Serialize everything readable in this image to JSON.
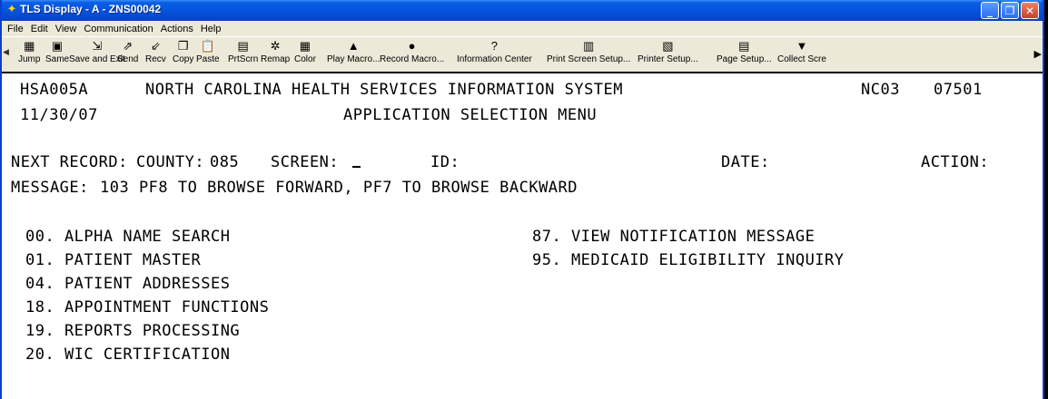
{
  "window": {
    "title": "TLS Display - A - ZNS00042"
  },
  "menu": [
    "File",
    "Edit",
    "View",
    "Communication",
    "Actions",
    "Help"
  ],
  "toolbar": [
    {
      "label": "Jump",
      "icon": "jump-icon",
      "glyph": "▦"
    },
    {
      "label": "Same",
      "icon": "same-icon",
      "glyph": "▣"
    },
    {
      "label": "Save and Exit",
      "icon": "save-exit-icon",
      "glyph": "⇲"
    },
    {
      "label": "Send",
      "icon": "send-icon",
      "glyph": "⇗"
    },
    {
      "label": "Recv",
      "icon": "recv-icon",
      "glyph": "⇙"
    },
    {
      "label": "Copy",
      "icon": "copy-icon",
      "glyph": "❐"
    },
    {
      "label": "Paste",
      "icon": "paste-icon",
      "glyph": "📋"
    },
    {
      "label": "PrtScrn",
      "icon": "print-screen-icon",
      "glyph": "▤"
    },
    {
      "label": "Remap",
      "icon": "remap-icon",
      "glyph": "✲"
    },
    {
      "label": "Color",
      "icon": "color-icon",
      "glyph": "▦"
    },
    {
      "label": "Play Macro...",
      "icon": "play-macro-icon",
      "glyph": "▲"
    },
    {
      "label": "Record Macro...",
      "icon": "record-macro-icon",
      "glyph": "●"
    },
    {
      "label": "Information Center",
      "icon": "information-icon",
      "glyph": "?"
    },
    {
      "label": "Print Screen Setup...",
      "icon": "print-setup-icon",
      "glyph": "▥"
    },
    {
      "label": "Printer Setup...",
      "icon": "printer-setup-icon",
      "glyph": "▧"
    },
    {
      "label": "Page Setup...",
      "icon": "page-setup-icon",
      "glyph": "▤"
    },
    {
      "label": "Collect Scre",
      "icon": "collect-screen-icon",
      "glyph": "▼"
    }
  ],
  "screen": {
    "program_id": "HSA005A",
    "system_title": "NORTH CAROLINA HEALTH SERVICES INFORMATION SYSTEM",
    "region": "NC03",
    "code": "07501",
    "date": "11/30/07",
    "menu_title": "APPLICATION SELECTION MENU",
    "next_record_label": "NEXT RECORD:",
    "county_label": "COUNTY:",
    "county_value": "085",
    "screen_label": "SCREEN:",
    "id_label": "ID:",
    "date_label": "DATE:",
    "action_label": "ACTION:",
    "message_label": "MESSAGE:",
    "message_text": "103 PF8 TO BROWSE FORWARD, PF7 TO BROWSE BACKWARD",
    "options_left": [
      "00. ALPHA NAME SEARCH",
      "01. PATIENT MASTER",
      "04. PATIENT ADDRESSES",
      "18. APPOINTMENT FUNCTIONS",
      "19. REPORTS PROCESSING",
      "20. WIC CERTIFICATION"
    ],
    "options_right": [
      "87. VIEW NOTIFICATION MESSAGE",
      "95. MEDICAID ELIGIBILITY INQUIRY"
    ]
  }
}
